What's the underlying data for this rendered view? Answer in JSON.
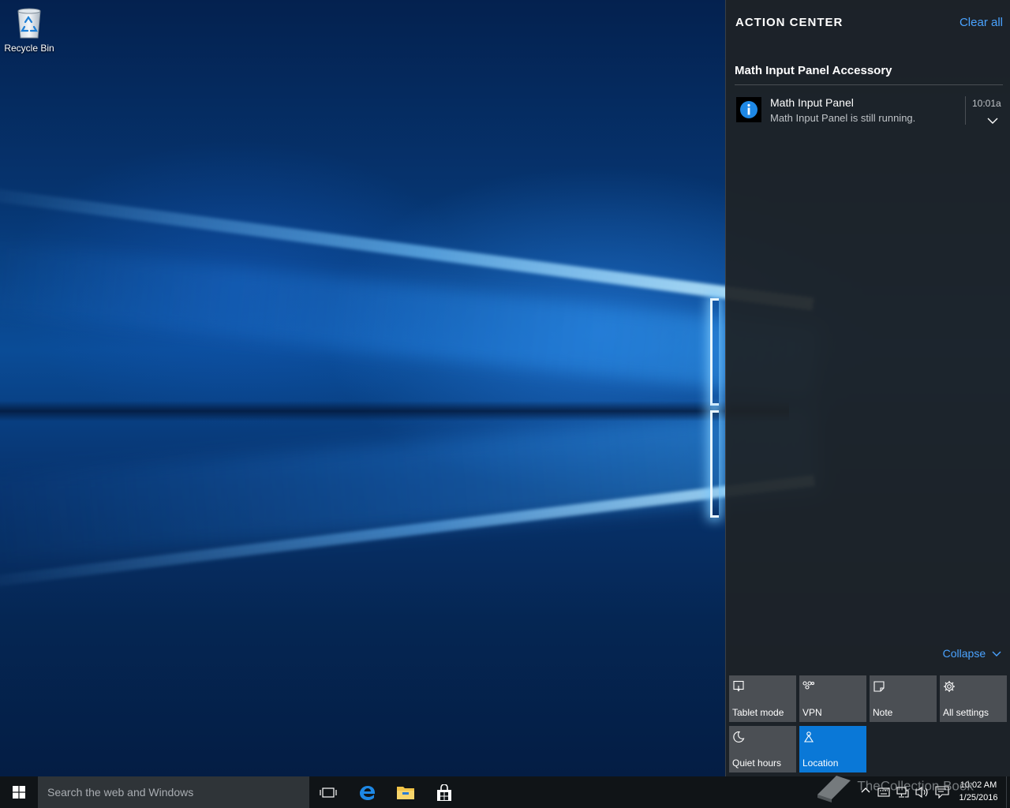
{
  "desktop": {
    "icons": [
      {
        "label": "Recycle Bin",
        "icon": "recycle-bin-icon"
      }
    ]
  },
  "action_center": {
    "title": "ACTION CENTER",
    "clear_all": "Clear all",
    "group_title": "Math Input Panel Accessory",
    "notification": {
      "icon": "info-icon",
      "title": "Math Input Panel",
      "body": "Math Input Panel is still running.",
      "time": "10:01a"
    },
    "collapse": "Collapse",
    "quick_actions": [
      {
        "label": "Tablet mode",
        "icon": "tablet-mode-icon",
        "active": false
      },
      {
        "label": "VPN",
        "icon": "vpn-icon",
        "active": false
      },
      {
        "label": "Note",
        "icon": "note-icon",
        "active": false
      },
      {
        "label": "All settings",
        "icon": "gear-icon",
        "active": false
      },
      {
        "label": "Quiet hours",
        "icon": "moon-icon",
        "active": false
      },
      {
        "label": "Location",
        "icon": "location-icon",
        "active": true
      }
    ],
    "accent_color": "#0a78d7",
    "link_color": "#4aa3ff"
  },
  "taskbar": {
    "search_placeholder": "Search the web and Windows",
    "pinned": [
      "task-view-icon",
      "edge-icon",
      "file-explorer-icon",
      "store-icon"
    ],
    "tray": [
      "chevron-up-icon",
      "keyboard-icon",
      "network-icon",
      "volume-icon",
      "action-center-icon"
    ],
    "clock": {
      "time": "10:02 AM",
      "date": "1/25/2016"
    }
  },
  "watermark": "TheCollection Book"
}
